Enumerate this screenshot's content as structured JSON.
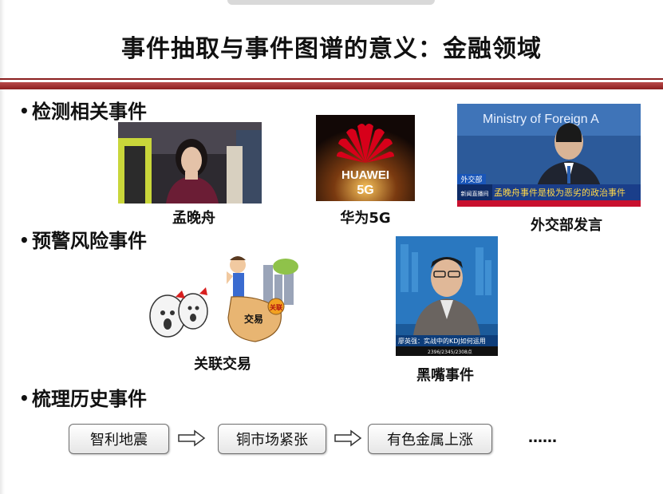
{
  "slide": {
    "title": "事件抽取与事件图谱的意义：金融领域"
  },
  "sections": [
    {
      "label": "检测相关事件"
    },
    {
      "label": "预警风险事件"
    },
    {
      "label": "梳理历史事件"
    }
  ],
  "images": {
    "meng": {
      "caption": "孟晚舟"
    },
    "huawei": {
      "caption": "华为5G",
      "logo_text": "HUAWEI",
      "logo_sub": "5G"
    },
    "mfa": {
      "caption": "外交部发言",
      "backdrop_text": "Ministry of Foreign A",
      "tag_text": "外交部",
      "ticker_text": "孟晚舟事件是极为恶劣的政治事件",
      "sub_ticker": "新闻直播间"
    },
    "related": {
      "caption": "关联交易",
      "bag_text": "交易",
      "tag_text": "关联"
    },
    "blackmouth": {
      "caption": "黑嘴事件",
      "ticker_text": "廖英强：实战中的KDJ如何运用",
      "sub_ticker": "2396/2345/2308点"
    }
  },
  "flow": {
    "steps": [
      "智利地震",
      "铜市场紧张",
      "有色金属上涨"
    ],
    "ellipsis": "……"
  },
  "colors": {
    "rule": "#8a1f1f",
    "huawei_red": "#d7001a",
    "ticker_blue": "#1a56b8",
    "ticker_red": "#c8102e"
  }
}
